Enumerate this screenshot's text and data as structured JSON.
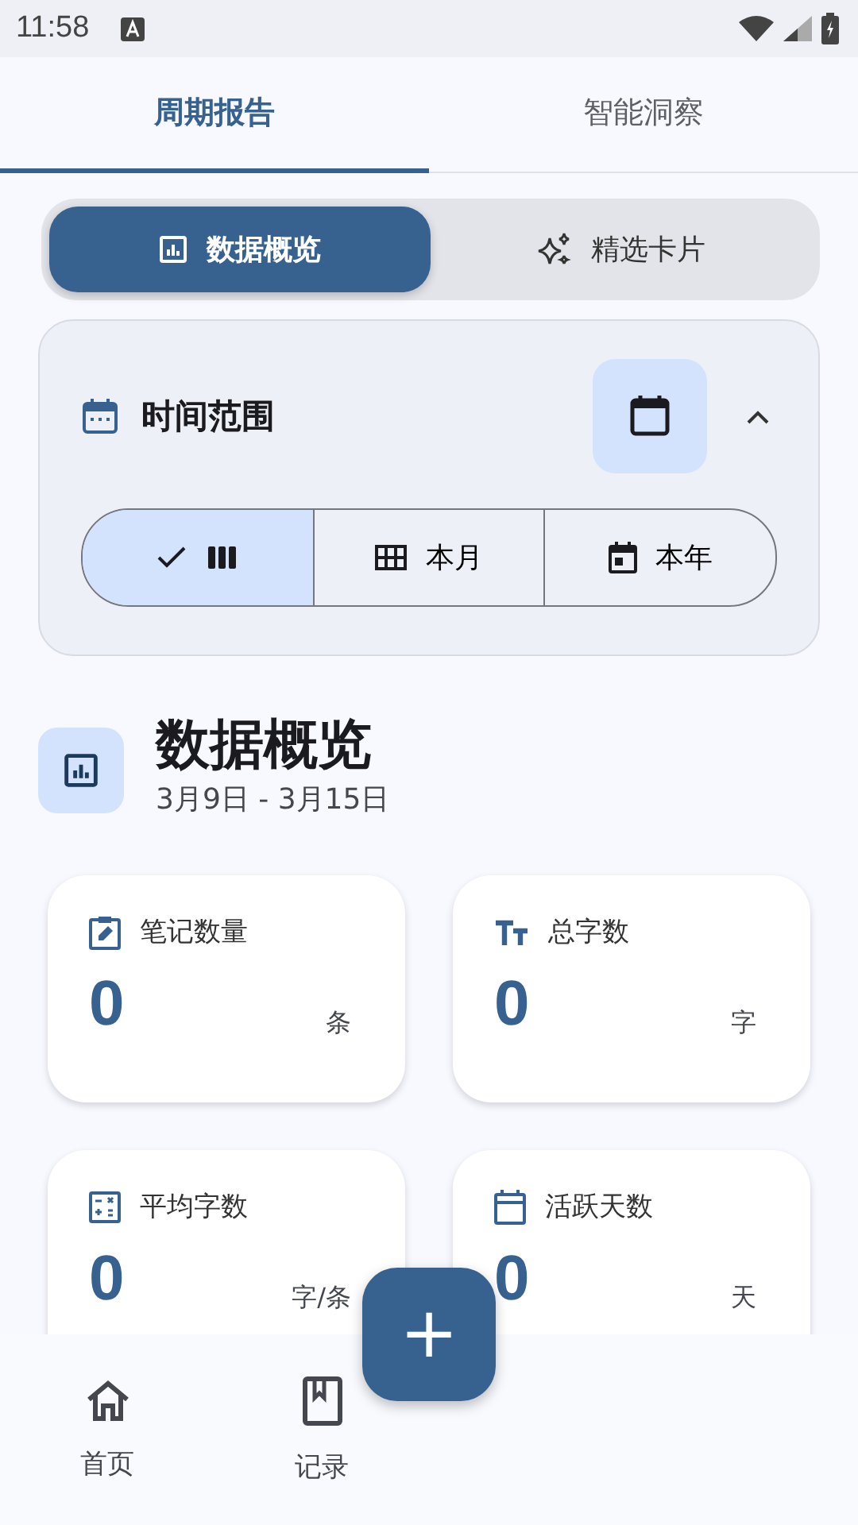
{
  "status_bar": {
    "time": "11:58"
  },
  "tabs": [
    {
      "label": "周期报告",
      "selected": true
    },
    {
      "label": "智能洞察",
      "selected": false
    }
  ],
  "view_toggle": [
    {
      "label": "数据概览",
      "selected": true
    },
    {
      "label": "精选卡片",
      "selected": false
    }
  ],
  "time_range": {
    "title": "时间范围",
    "expanded": true,
    "segments": [
      {
        "selected": true
      },
      {
        "label": "本月",
        "selected": false
      },
      {
        "label": "本年",
        "selected": false
      }
    ]
  },
  "overview": {
    "title": "数据概览",
    "date_range": "3月9日 - 3月15日"
  },
  "stats": [
    {
      "label": "笔记数量",
      "value": "0",
      "unit": "条"
    },
    {
      "label": "总字数",
      "value": "0",
      "unit": "字"
    },
    {
      "label": "平均字数",
      "value": "0",
      "unit": "字/条"
    },
    {
      "label": "活跃天数",
      "value": "0",
      "unit": "天"
    }
  ],
  "fab": {
    "label": "+"
  },
  "bottom_nav": [
    {
      "label": "首页",
      "selected": false
    },
    {
      "label": "记录",
      "selected": false
    }
  ]
}
